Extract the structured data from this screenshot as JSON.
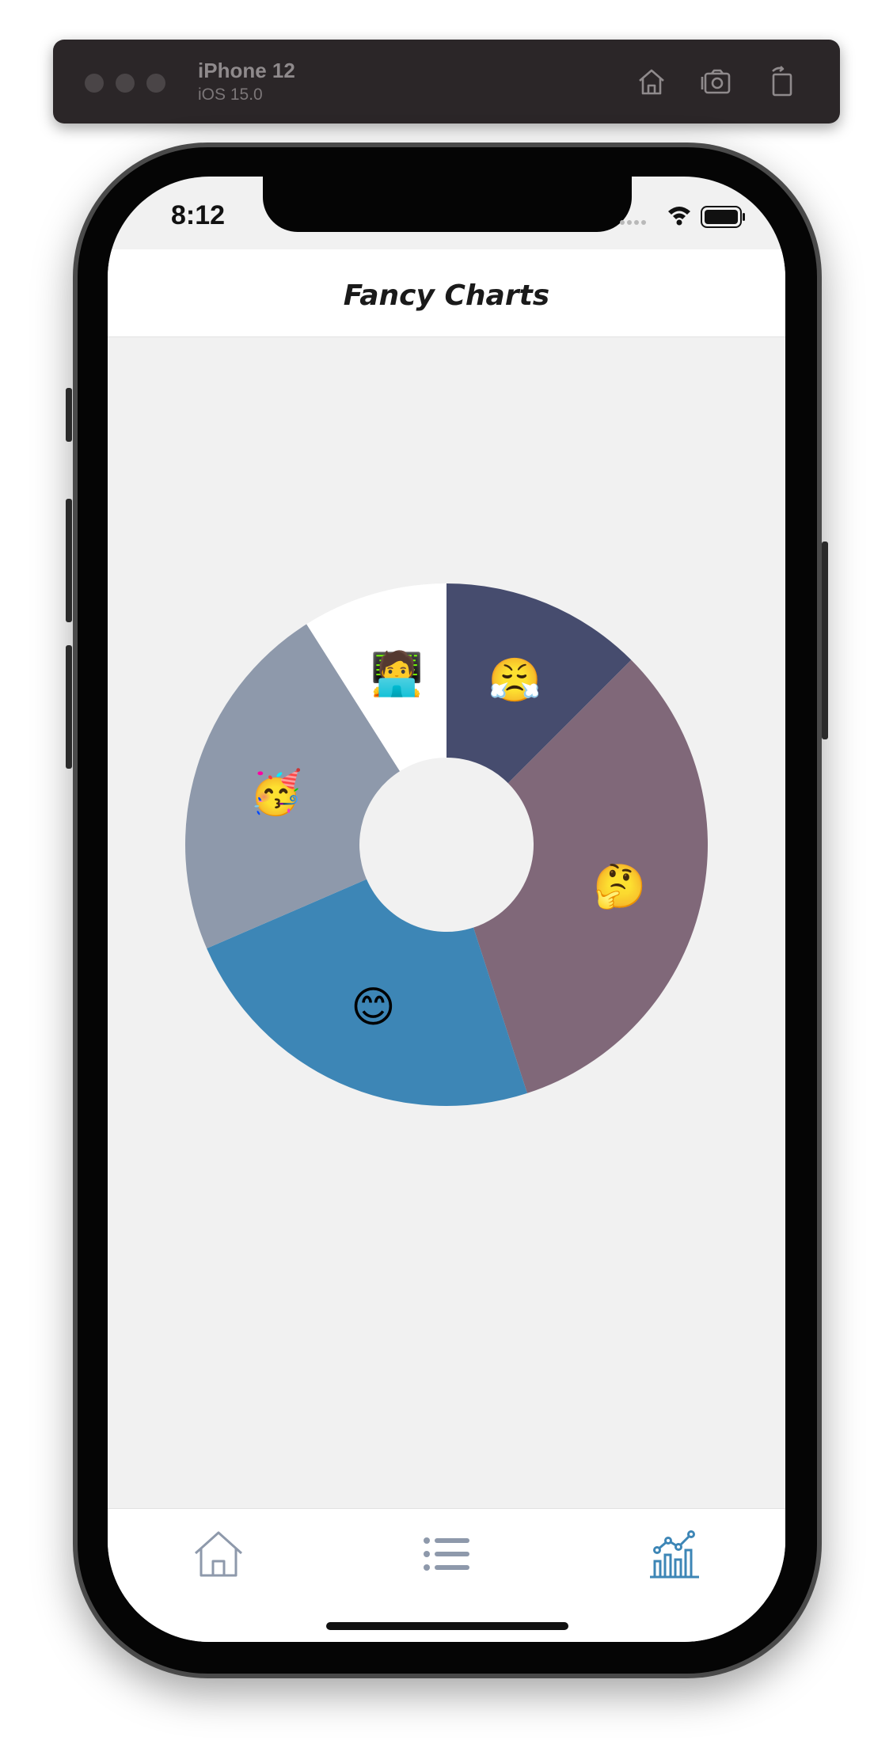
{
  "simulator": {
    "device_name": "iPhone 12",
    "os_version": "iOS 15.0",
    "buttons": [
      "home-icon",
      "screenshot-icon",
      "rotate-icon"
    ]
  },
  "status_bar": {
    "time": "8:12",
    "icons": [
      "cellular-dots-icon",
      "wifi-icon",
      "battery-icon"
    ]
  },
  "header": {
    "title": "Fancy Charts"
  },
  "chart_data": {
    "type": "pie",
    "variant": "donut",
    "start_angle": "top",
    "direction": "clockwise",
    "categories": [
      "😤",
      "🤔",
      "😊",
      "🥳",
      "🧑‍💻"
    ],
    "values": [
      12.5,
      32.5,
      23.5,
      22.5,
      9.0
    ],
    "unit": "%",
    "colors": [
      "#464c6e",
      "#806879",
      "#3d86b6",
      "#8e99ab",
      "#ffffff"
    ],
    "title": "",
    "legend": "none"
  },
  "tab_bar": {
    "tabs": [
      {
        "icon": "home-icon",
        "active": false
      },
      {
        "icon": "list-icon",
        "active": false
      },
      {
        "icon": "chart-icon",
        "active": true
      }
    ],
    "active_color": "#3d86b6",
    "inactive_color": "#8e99ab"
  }
}
